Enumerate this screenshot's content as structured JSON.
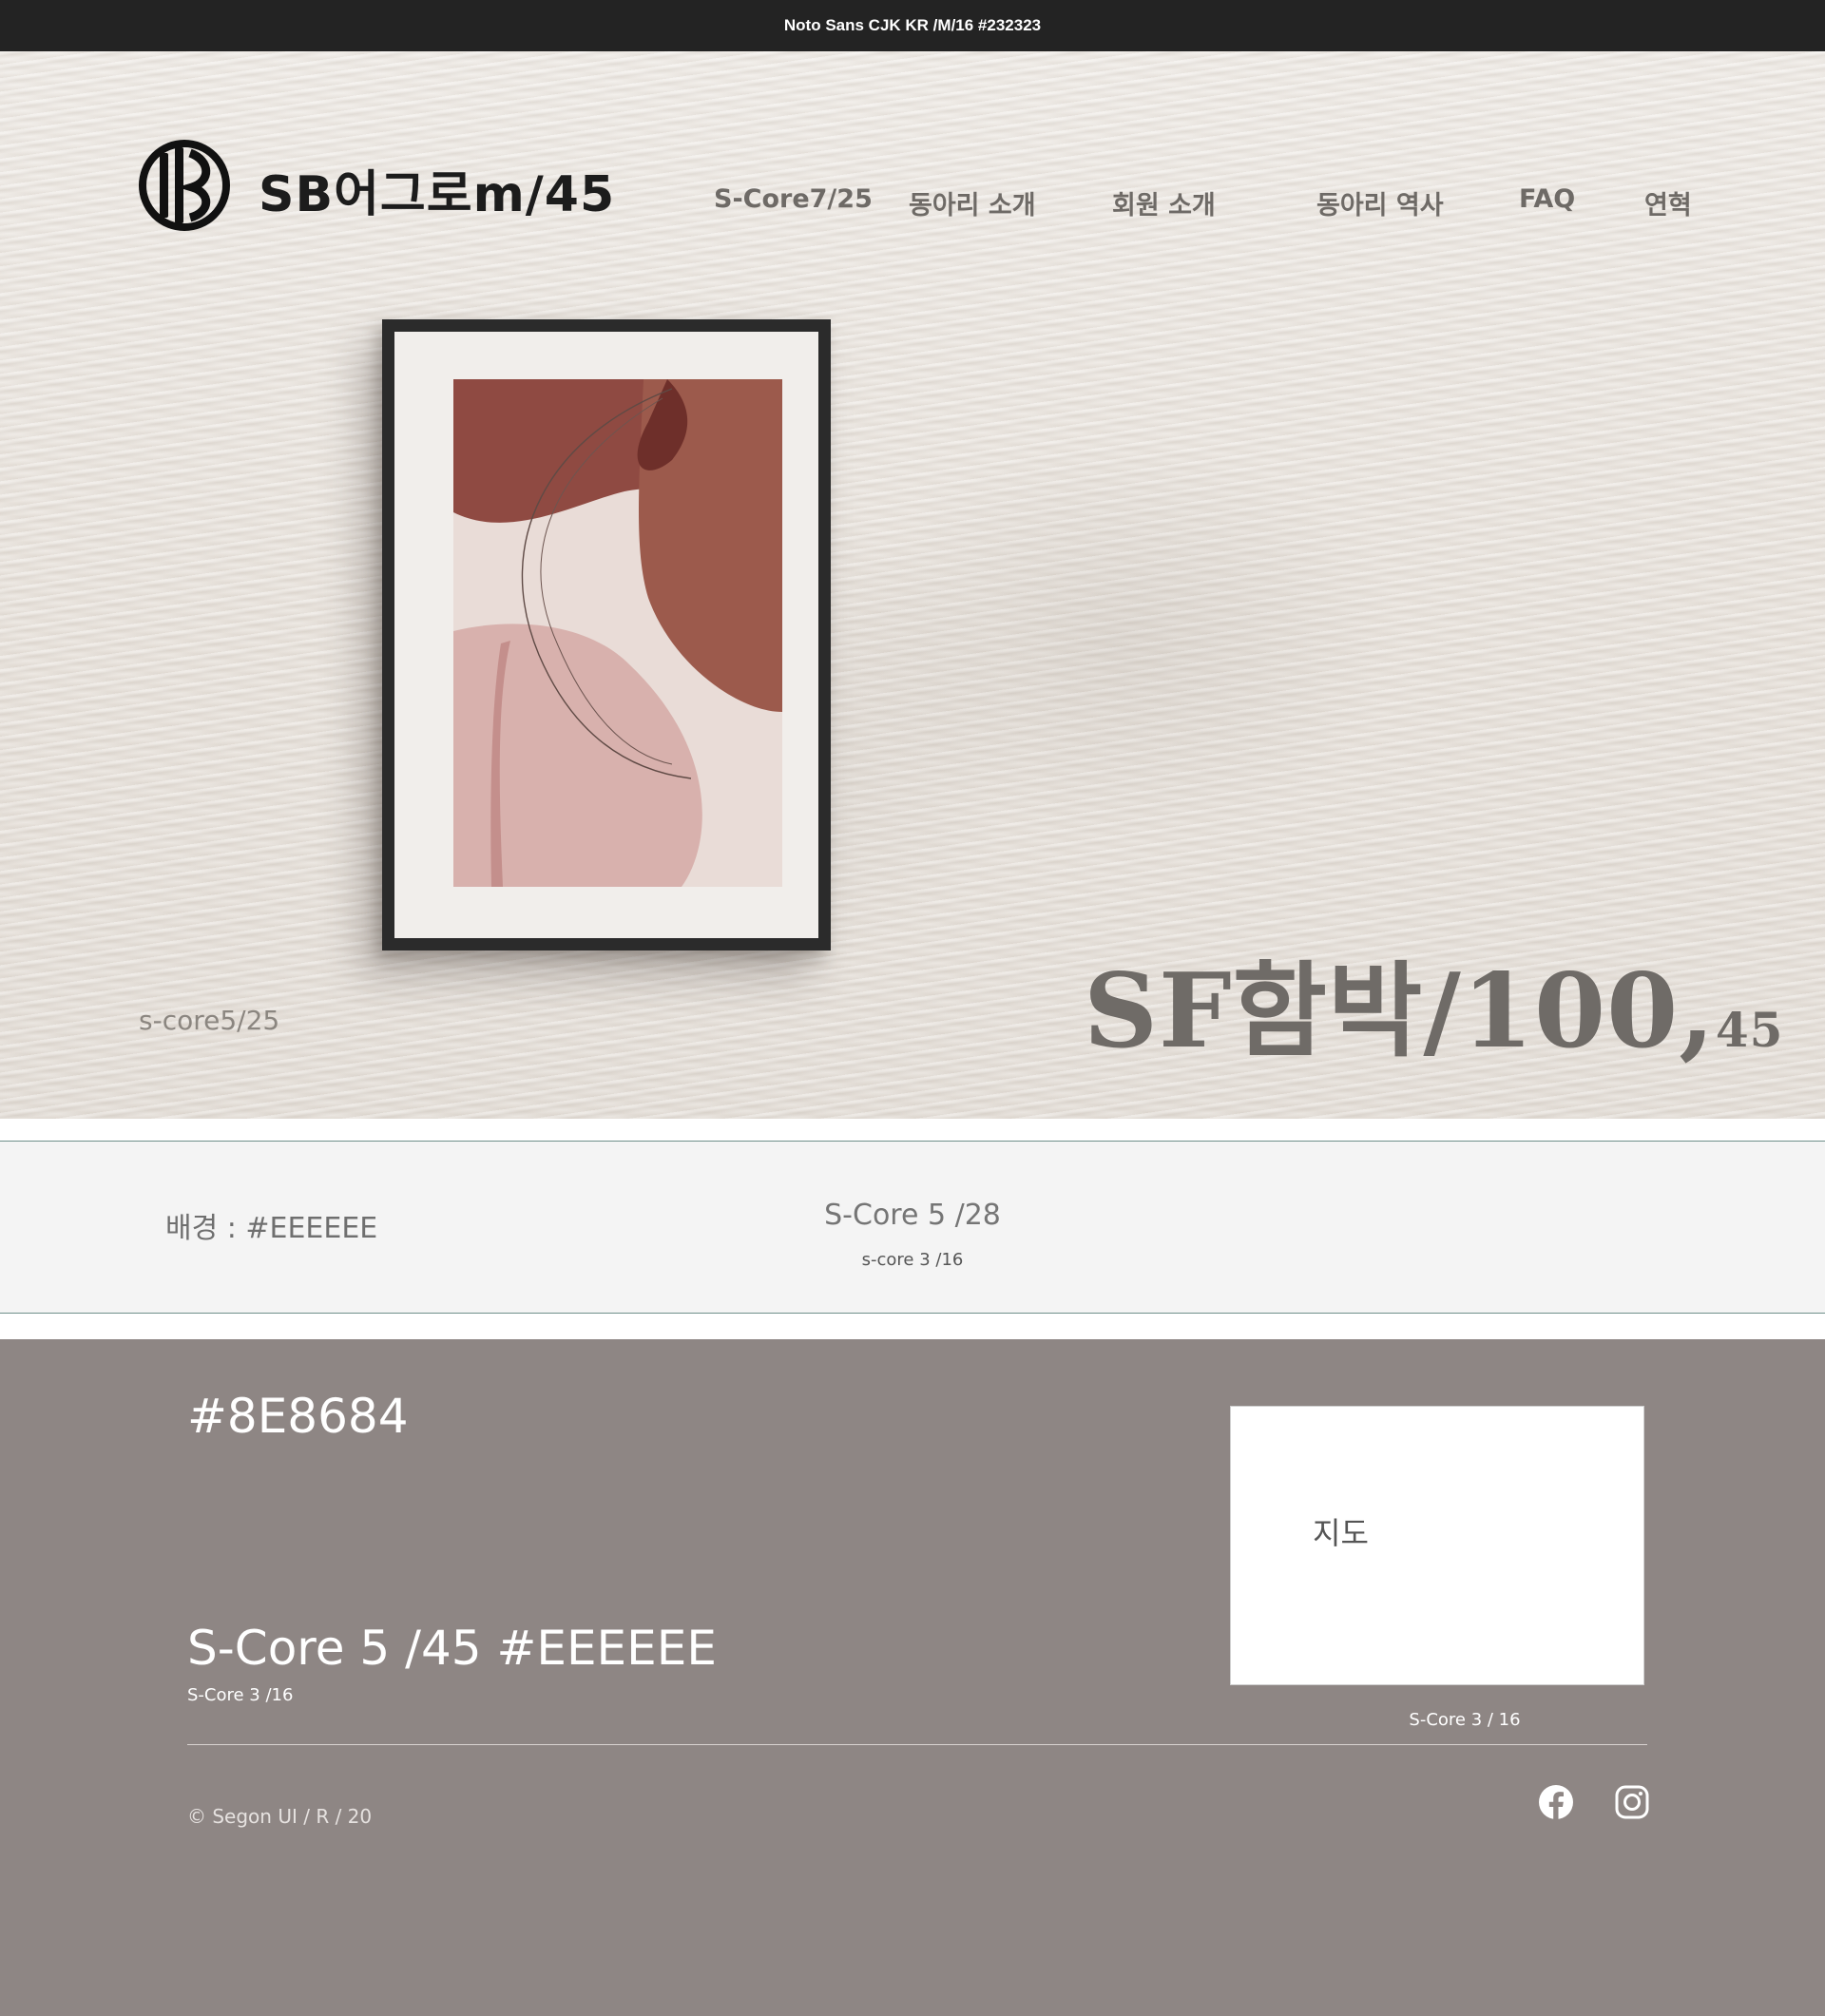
{
  "topbar": {
    "text": "Noto Sans CJK KR /M/16  #232323"
  },
  "header": {
    "logo_text": "SB어그로m/45",
    "logo_icon": "circle-stripes-logo-icon",
    "nav": [
      {
        "label": "S-Core7/25"
      },
      {
        "label": "동아리 소개"
      },
      {
        "label": "회원 소개"
      },
      {
        "label": "동아리 역사"
      },
      {
        "label": "FAQ"
      },
      {
        "label": "연혁"
      }
    ]
  },
  "hero": {
    "caption": "s-core5/25",
    "title": "SF함박/100,",
    "title_small": "45"
  },
  "band": {
    "left_text": "배경 : #EEEEEE",
    "center_title": "S-Core 5 /28",
    "center_sub": "s-core 3 /16"
  },
  "footer": {
    "background": "#8E8684",
    "color_title": "#8E8684",
    "heading": "S-Core 5 /45 #EEEEEE",
    "sub": "S-Core 3 /16",
    "map_label": "지도",
    "map_caption": "S-Core 3 / 16",
    "copyright": "© Segon UI / R / 20",
    "social_icons": [
      "facebook-icon",
      "instagram-icon"
    ]
  }
}
